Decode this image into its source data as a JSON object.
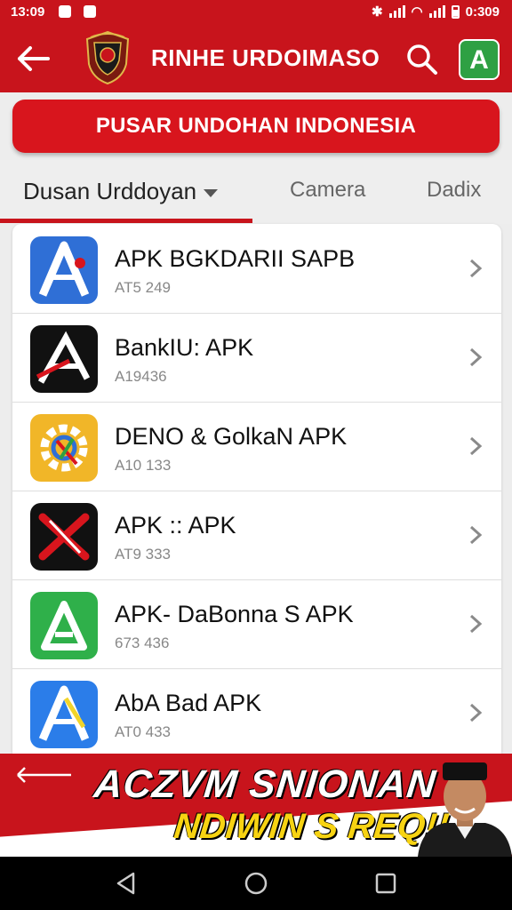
{
  "status_bar": {
    "time": "13:09",
    "right_text": "0:309"
  },
  "app_bar": {
    "title": "RINHE URDOIMASO",
    "action_label": "A"
  },
  "banner_button": {
    "label": "PUSAR UNDOHAN INDONESIA"
  },
  "tabs": [
    {
      "label": "Dusan Urddoyan"
    },
    {
      "label": "Camera"
    },
    {
      "label": "Dadix"
    }
  ],
  "apps": [
    {
      "name": "APK BGKDARII SAPB",
      "sub": "AT5 249",
      "icon": "blue-a-icon"
    },
    {
      "name": "BankIU: APK",
      "sub": "A19436",
      "icon": "black-a-icon"
    },
    {
      "name": "DENO & GolkaN APK",
      "sub": "A10 133",
      "icon": "yellow-gear-icon"
    },
    {
      "name": "APK :: APK",
      "sub": "AT9 333",
      "icon": "red-x-icon"
    },
    {
      "name": "APK- DaBonna S APK",
      "sub": "673 436",
      "icon": "green-a-icon"
    },
    {
      "name": "AbA Bad APK",
      "sub": "AT0 433",
      "icon": "blue-a-icon"
    }
  ],
  "ad": {
    "line1": "ACZVM SNIONAN",
    "line2": "NDIWIN S REQ!!"
  },
  "colors": {
    "brand_red": "#c8141c",
    "ad_yellow": "#f7d312",
    "green": "#2ea043"
  }
}
